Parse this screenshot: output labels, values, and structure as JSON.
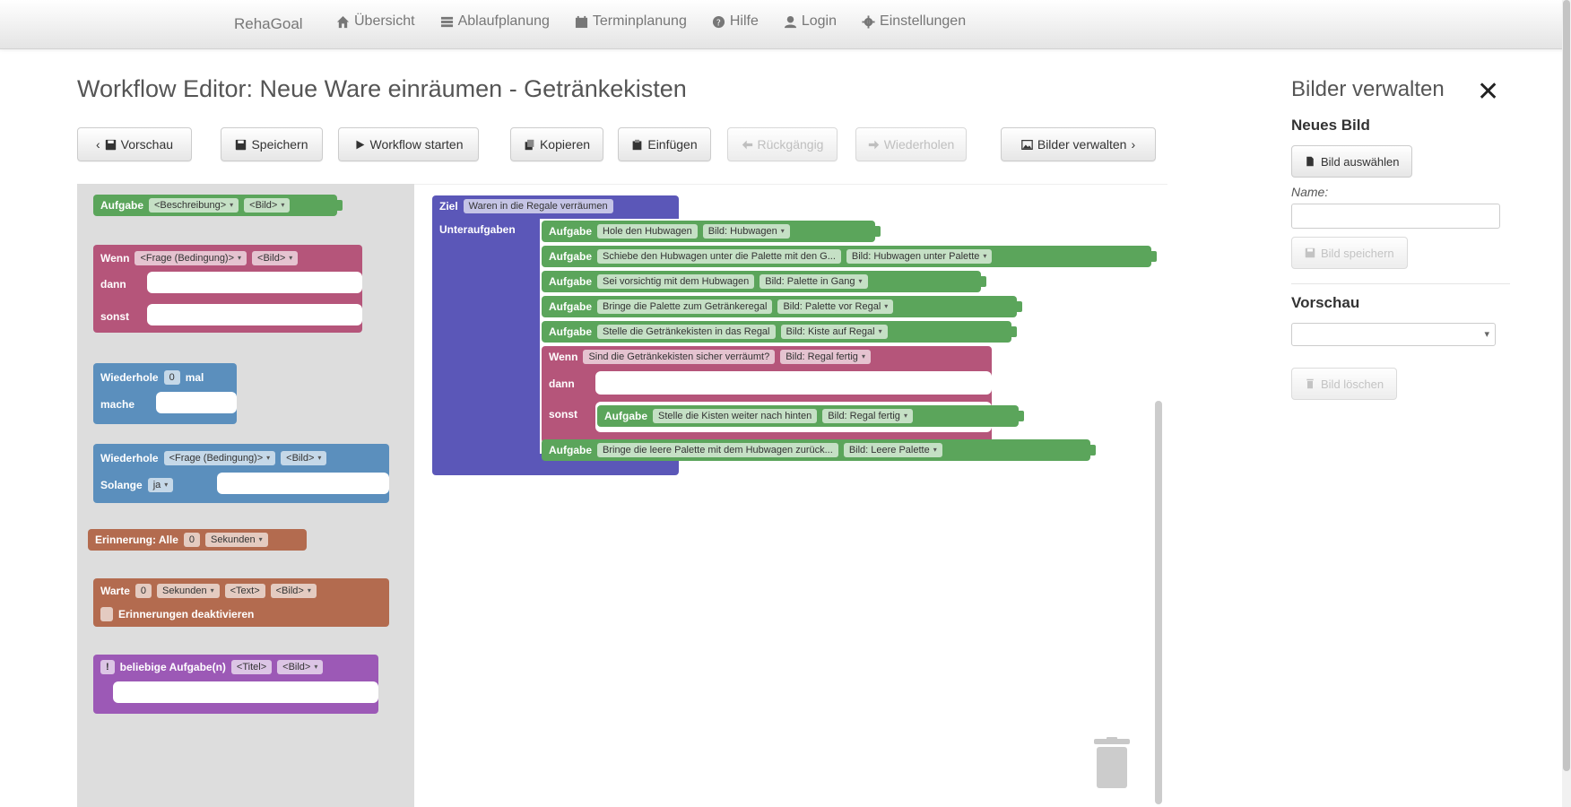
{
  "nav": {
    "brand": "RehaGoal",
    "items": [
      {
        "icon": "home-icon",
        "label": "Übersicht"
      },
      {
        "icon": "list-icon",
        "label": "Ablaufplanung"
      },
      {
        "icon": "calendar-icon",
        "label": "Terminplanung"
      },
      {
        "icon": "help-icon",
        "label": "Hilfe"
      },
      {
        "icon": "user-icon",
        "label": "Login"
      },
      {
        "icon": "gear-icon",
        "label": "Einstellungen"
      }
    ]
  },
  "editor": {
    "title": "Workflow Editor: Neue Ware einräumen - Getränkekisten",
    "toolbar": {
      "preview": "Vorschau",
      "save": "Speichern",
      "start": "Workflow starten",
      "copy": "Kopieren",
      "paste": "Einfügen",
      "undo": "Rückgängig",
      "redo": "Wiederholen",
      "manage_images": "Bilder verwalten"
    }
  },
  "flyout": {
    "task": {
      "label": "Aufgabe",
      "desc": "<Beschreibung>",
      "image": "<Bild>"
    },
    "if": {
      "label": "Wenn",
      "question": "<Frage (Bedingung)>",
      "image": "<Bild>",
      "then": "dann",
      "else": "sonst"
    },
    "repeat_times": {
      "label": "Wiederhole",
      "count": "0",
      "times": "mal",
      "do": "mache"
    },
    "repeat_while": {
      "label": "Wiederhole",
      "question": "<Frage (Bedingung)>",
      "image": "<Bild>",
      "while": "Solange",
      "yes": "ja"
    },
    "reminder": {
      "label": "Erinnerung: Alle",
      "count": "0",
      "unit": "Sekunden"
    },
    "wait": {
      "label": "Warte",
      "count": "0",
      "unit": "Sekunden",
      "text": "<Text>",
      "image": "<Bild>",
      "disable": "Erinnerungen deaktivieren"
    },
    "any": {
      "badge": "!",
      "label": "beliebige Aufgabe(n)",
      "title": "<Titel>",
      "image": "<Bild>"
    }
  },
  "workspace": {
    "goal": {
      "label": "Ziel",
      "value": "Waren in die Regale verräumen"
    },
    "subtasks_label": "Unteraufgaben",
    "tasks": [
      {
        "label": "Aufgabe",
        "text": "Hole den Hubwagen",
        "image": "Bild: Hubwagen"
      },
      {
        "label": "Aufgabe",
        "text": "Schiebe den Hubwagen unter die Palette mit den G...",
        "image": "Bild: Hubwagen unter Palette"
      },
      {
        "label": "Aufgabe",
        "text": "Sei vorsichtig mit dem Hubwagen",
        "image": "Bild: Palette in Gang"
      },
      {
        "label": "Aufgabe",
        "text": "Bringe die Palette zum Getränkeregal",
        "image": "Bild: Palette vor Regal"
      },
      {
        "label": "Aufgabe",
        "text": "Stelle die Getränkekisten in das Regal",
        "image": "Bild: Kiste auf Regal"
      }
    ],
    "condition": {
      "label": "Wenn",
      "question": "Sind die Getränkekisten sicher verräumt?",
      "image": "Bild: Regal fertig",
      "then": "dann",
      "else": "sonst",
      "else_task": {
        "label": "Aufgabe",
        "text": "Stelle die Kisten weiter nach hinten",
        "image": "Bild: Regal fertig"
      }
    },
    "last_task": {
      "label": "Aufgabe",
      "text": "Bringe die leere Palette mit dem Hubwagen zurück...",
      "image": "Bild: Leere Palette"
    }
  },
  "panel": {
    "title": "Bilder verwalten",
    "new_image": "Neues Bild",
    "choose": "Bild auswählen",
    "name_label": "Name:",
    "name_value": "",
    "save": "Bild speichern",
    "preview": "Vorschau",
    "select_value": "",
    "delete": "Bild löschen"
  },
  "colors": {
    "task": "#5ba55b",
    "if": "#b5557a",
    "loop": "#5b8fbd",
    "reminder": "#b36b4f",
    "any": "#9c59b6",
    "goal": "#5b57b8"
  }
}
